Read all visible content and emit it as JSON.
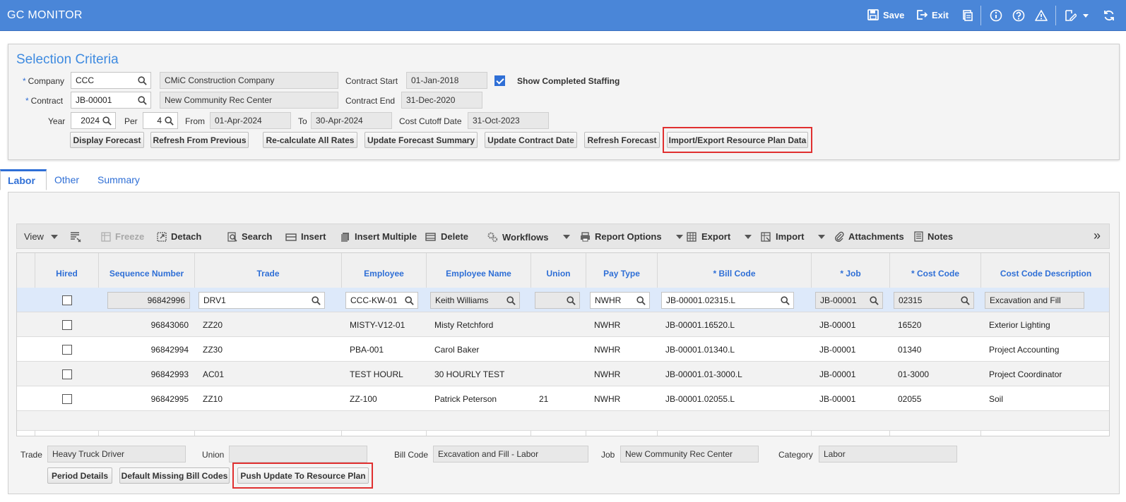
{
  "app": {
    "title": "GC MONITOR",
    "save_label": "Save",
    "exit_label": "Exit"
  },
  "colors": {
    "header": "#4a86d8",
    "accent": "#2f6fd6",
    "highlight": "#e03030"
  },
  "icons": [
    "save-icon",
    "exit-icon",
    "print-icon",
    "info-icon",
    "help-icon",
    "warning-icon",
    "edit-icon",
    "refresh-icon",
    "search-icon"
  ],
  "criteria": {
    "title": "Selection Criteria",
    "company_label": "Company",
    "company_value": "CCC",
    "company_name": "CMiC Construction Company",
    "contract_label": "Contract",
    "contract_value": "JB-00001",
    "contract_name": "New Community Rec Center",
    "contract_start_label": "Contract Start",
    "contract_start_value": "01-Jan-2018",
    "contract_end_label": "Contract End",
    "contract_end_value": "31-Dec-2020",
    "show_completed_label": "Show Completed Staffing",
    "show_completed_checked": true,
    "year_label": "Year",
    "year_value": "2024",
    "per_label": "Per",
    "per_value": "4",
    "from_label": "From",
    "from_value": "01-Apr-2024",
    "to_label": "To",
    "to_value": "30-Apr-2024",
    "cutoff_label": "Cost Cutoff Date",
    "cutoff_value": "31-Oct-2023",
    "buttons": {
      "display_forecast": "Display Forecast",
      "refresh_previous": "Refresh From Previous",
      "recalc_rates": "Re-calculate All Rates",
      "update_summary": "Update Forecast Summary",
      "update_contract_date": "Update Contract Date",
      "refresh_forecast": "Refresh Forecast",
      "import_export": "Import/Export Resource Plan Data"
    }
  },
  "tabs": [
    {
      "label": "Labor",
      "active": true
    },
    {
      "label": "Other",
      "active": false
    },
    {
      "label": "Summary",
      "active": false
    }
  ],
  "toolbar": {
    "view": "View",
    "freeze": "Freeze",
    "detach": "Detach",
    "search": "Search",
    "insert": "Insert",
    "insert_multiple": "Insert Multiple",
    "delete": "Delete",
    "workflows": "Workflows",
    "report_options": "Report Options",
    "export": "Export",
    "import": "Import",
    "attachments": "Attachments",
    "notes": "Notes",
    "more": "»"
  },
  "grid": {
    "columns": [
      "Hired",
      "Sequence Number",
      "Trade",
      "Employee",
      "Employee Name",
      "Union",
      "Pay Type",
      "* Bill Code",
      "* Job",
      "* Cost Code",
      "Cost Code Description"
    ],
    "rows": [
      {
        "hired": false,
        "seq": "96842996",
        "trade": "DRV1",
        "employee": "CCC-KW-01",
        "name": "Keith Williams",
        "union": "",
        "pay_type": "NWHR",
        "bill_code": "JB-00001.02315.L",
        "job": "JB-00001",
        "cost_code": "02315",
        "description": "Excavation and Fill"
      },
      {
        "hired": false,
        "seq": "96843060",
        "trade": "ZZ20",
        "employee": "MISTY-V12-01",
        "name": "Misty Retchford",
        "union": "",
        "pay_type": "NWHR",
        "bill_code": "JB-00001.16520.L",
        "job": "JB-00001",
        "cost_code": "16520",
        "description": "Exterior Lighting"
      },
      {
        "hired": false,
        "seq": "96842994",
        "trade": "ZZ30",
        "employee": "PBA-001",
        "name": "Carol Baker",
        "union": "",
        "pay_type": "NWHR",
        "bill_code": "JB-00001.01340.L",
        "job": "JB-00001",
        "cost_code": "01340",
        "description": "Project Accounting"
      },
      {
        "hired": false,
        "seq": "96842993",
        "trade": "AC01",
        "employee": "TEST HOURL",
        "name": "30 HOURLY TEST",
        "union": "",
        "pay_type": "NWHR",
        "bill_code": "JB-00001.01-3000.L",
        "job": "JB-00001",
        "cost_code": "01-3000",
        "description": "Project Coordinator"
      },
      {
        "hired": false,
        "seq": "96842995",
        "trade": "ZZ10",
        "employee": "ZZ-100",
        "name": "Patrick Peterson",
        "union": "21",
        "pay_type": "NWHR",
        "bill_code": "JB-00001.02055.L",
        "job": "JB-00001",
        "cost_code": "02055",
        "description": "Soil"
      }
    ]
  },
  "detail": {
    "trade_label": "Trade",
    "trade_value": "Heavy Truck Driver",
    "union_label": "Union",
    "union_value": "",
    "bill_code_label": "Bill Code",
    "bill_code_value": "Excavation and Fill - Labor",
    "job_label": "Job",
    "job_value": "New Community Rec Center",
    "category_label": "Category",
    "category_value": "Labor",
    "buttons": {
      "period_details": "Period Details",
      "default_missing": "Default Missing Bill Codes",
      "push_update": "Push Update To Resource Plan"
    }
  }
}
